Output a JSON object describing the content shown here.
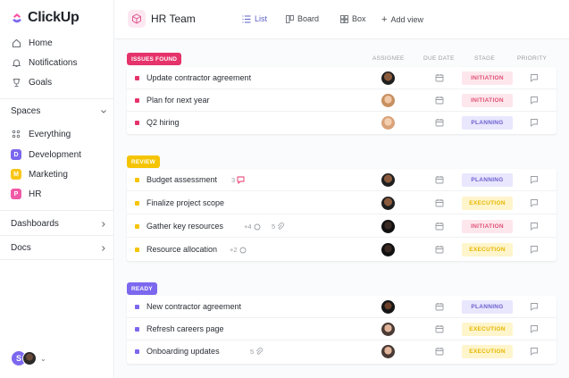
{
  "app": {
    "name": "ClickUp"
  },
  "sidebar": {
    "nav": [
      {
        "label": "Home",
        "icon": "home-icon"
      },
      {
        "label": "Notifications",
        "icon": "bell-icon"
      },
      {
        "label": "Goals",
        "icon": "trophy-icon"
      }
    ],
    "spaces_label": "Spaces",
    "everything_label": "Everything",
    "spaces": [
      {
        "letter": "D",
        "label": "Development",
        "color": "#7b68ee"
      },
      {
        "letter": "M",
        "label": "Marketing",
        "color": "#f9c517"
      },
      {
        "letter": "P",
        "label": "HR",
        "color": "#f05aa7"
      }
    ],
    "dashboards_label": "Dashboards",
    "docs_label": "Docs",
    "user_initial": "S"
  },
  "header": {
    "title": "HR Team",
    "views": [
      {
        "label": "List",
        "icon": "list-icon",
        "active": true
      },
      {
        "label": "Board",
        "icon": "board-icon",
        "active": false
      },
      {
        "label": "Box",
        "icon": "box-icon",
        "active": false
      },
      {
        "label": "Add view",
        "icon": "plus-icon",
        "active": false
      }
    ]
  },
  "columns": {
    "assignee": "ASSIGNEE",
    "due_date": "DUE DATE",
    "stage": "STAGE",
    "priority": "PRIORITY"
  },
  "groups": [
    {
      "label": "ISSUES FOUND",
      "color": "#e5336b",
      "tasks": [
        {
          "name": "Update contractor agreement",
          "stage": "INITIATION",
          "stage_class": "st-initiation",
          "meta": ""
        },
        {
          "name": "Plan for next year",
          "stage": "INITIATION",
          "stage_class": "st-initiation",
          "meta": ""
        },
        {
          "name": "Q2 hiring",
          "stage": "PLANNING",
          "stage_class": "st-planning",
          "meta": ""
        }
      ]
    },
    {
      "label": "REVIEW",
      "color": "#f5c400",
      "tasks": [
        {
          "name": "Budget assessment",
          "stage": "PLANNING",
          "stage_class": "st-planning",
          "meta": "3"
        },
        {
          "name": "Finalize project scope",
          "stage": "EXECUTION",
          "stage_class": "st-execution",
          "meta": ""
        },
        {
          "name": "Gather key resources",
          "stage": "INITIATION",
          "stage_class": "st-initiation",
          "meta": "+4",
          "attach": "5"
        },
        {
          "name": "Resource allocation",
          "stage": "EXECUTION",
          "stage_class": "st-execution",
          "meta": "+2"
        }
      ]
    },
    {
      "label": "READY",
      "color": "#7b68ee",
      "tasks": [
        {
          "name": "New contractor agreement",
          "stage": "PLANNING",
          "stage_class": "st-planning",
          "meta": ""
        },
        {
          "name": "Refresh careers page",
          "stage": "EXECUTION",
          "stage_class": "st-execution",
          "meta": ""
        },
        {
          "name": "Onboarding updates",
          "stage": "EXECUTION",
          "stage_class": "st-execution",
          "meta": "",
          "attach": "5"
        }
      ]
    }
  ]
}
